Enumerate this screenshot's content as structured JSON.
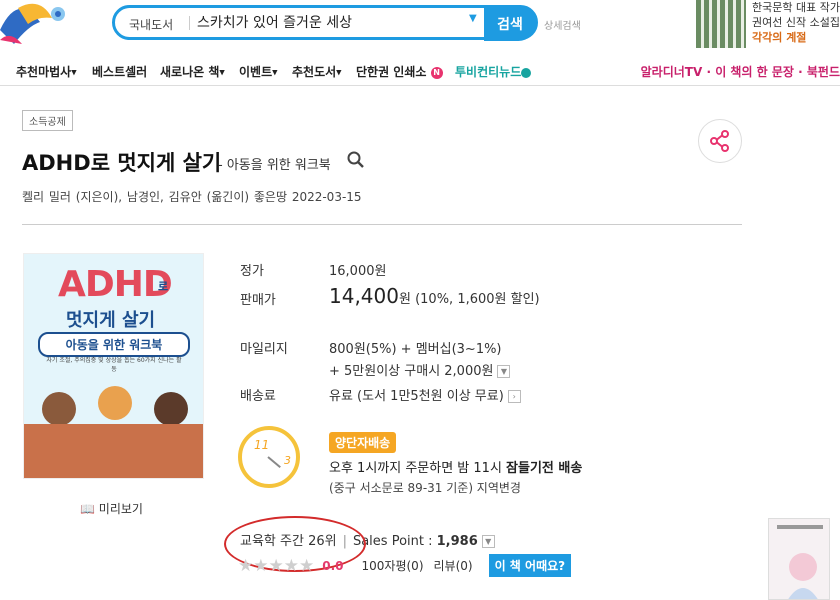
{
  "header": {
    "search_category": "국내도서",
    "search_value": "스카치가 있어 즐거운 세상",
    "search_button": "검색",
    "detail_search": "상세검색",
    "ad_lines": [
      "한국문학 대표 작가",
      "권여선 신작 소설집",
      "각각의 계절"
    ]
  },
  "nav": {
    "items": [
      "추천마법사",
      "베스트셀러",
      "새로나온 책",
      "이벤트",
      "추천도서",
      "단한권 인쇄소",
      "투비컨티뉴드"
    ],
    "new_badge": "N",
    "right_text": "알라디너TV · 이 책의 한 문장 · 북펀드"
  },
  "book": {
    "badge": "소득공제",
    "title": "ADHD로 멋지게 살기",
    "subtitle": "- 아동을 위한 워크북",
    "authors": "켈리 밀러 (지은이),  남경인,  김유안 (옮긴이)  좋은땅  2022-03-15",
    "cover": {
      "title_big": "ADHD",
      "title_ro": "로",
      "title_line2": "멋지게 살기",
      "subtitle": "아동을 위한 워크북",
      "desc": "자기 조절, 주의집중 및 상상을 돕는 60가지 신나는 활동"
    },
    "preview": "미리보기"
  },
  "price": {
    "list_label": "정가",
    "list_value": "16,000원",
    "sale_label": "판매가",
    "sale_value": "14,400",
    "sale_unit": "원",
    "sale_discount": "(10%, 1,600원 할인)",
    "mileage_label": "마일리지",
    "mileage_line1": "800원(5%) + 멤버십(3~1%)",
    "mileage_line2": "+ 5만원이상 구매시 2,000원",
    "shipping_label": "배송료",
    "shipping_value": "유료 (도서 1만5천원 이상 무료)"
  },
  "delivery": {
    "badge": "양단자배송",
    "clock_11": "11",
    "clock_3": "3",
    "line_prefix": "오후 1시까지 주문하면 밤 11시 ",
    "line_bold": "잠들기전 배송",
    "address": "(중구 서소문로 89-31 기준) 지역변경"
  },
  "rank": {
    "rank_text": "교육학 주간 26위",
    "sep": "|",
    "sales_label": "Sales Point : ",
    "sales_value": "1,986"
  },
  "rating": {
    "stars": 0,
    "score": "0.0",
    "comments": "100자평(0)",
    "reviews": "리뷰(0)",
    "ask_button": "이 책 어때요?"
  },
  "colors": {
    "accent": "#1e9be1",
    "price_highlight": "#e43b6d",
    "annotation": "#d32b2b"
  }
}
